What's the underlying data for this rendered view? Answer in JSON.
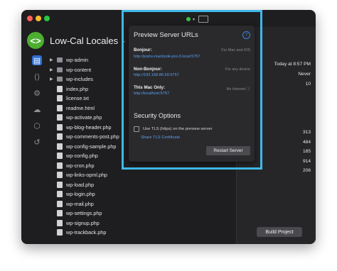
{
  "project": {
    "name": "Low-Cal Locales",
    "logo_glyph": "<>"
  },
  "sidebar_icons": [
    "files-icon",
    "code-icon",
    "settings-icon",
    "cloud-icon",
    "box-icon",
    "history-icon"
  ],
  "files": [
    {
      "name": "wp-admin",
      "type": "folder"
    },
    {
      "name": "wp-content",
      "type": "folder"
    },
    {
      "name": "wp-includes",
      "type": "folder"
    },
    {
      "name": "index.php",
      "type": "file"
    },
    {
      "name": "license.txt",
      "type": "file"
    },
    {
      "name": "readme.html",
      "type": "file"
    },
    {
      "name": "wp-activate.php",
      "type": "file"
    },
    {
      "name": "wp-blog-header.php",
      "type": "file"
    },
    {
      "name": "wp-comments-post.php",
      "type": "file"
    },
    {
      "name": "wp-config-sample.php",
      "type": "file"
    },
    {
      "name": "wp-config.php",
      "type": "file"
    },
    {
      "name": "wp-cron.php",
      "type": "file"
    },
    {
      "name": "wp-links-opml.php",
      "type": "file"
    },
    {
      "name": "wp-load.php",
      "type": "file"
    },
    {
      "name": "wp-login.php",
      "type": "file"
    },
    {
      "name": "wp-mail.php",
      "type": "file"
    },
    {
      "name": "wp-settings.php",
      "type": "file"
    },
    {
      "name": "wp-signup.php",
      "type": "file"
    },
    {
      "name": "wp-trackback.php",
      "type": "file"
    }
  ],
  "right_panel": {
    "values_top": [
      "Today at 8:57 PM",
      "Never",
      "10"
    ],
    "values_bottom": [
      "313",
      "484",
      "185",
      "914",
      "206"
    ],
    "build_button": "Build Project"
  },
  "popover": {
    "title": "Preview Server URLs",
    "help": "?",
    "sections": [
      {
        "label": "Bonjour:",
        "note": "For Mac and iOS",
        "url": "http://joshs-macbook-pro-3.local:5757"
      },
      {
        "label": "Non-Bonjour:",
        "note": "For any device",
        "url": "http://192.168.86.69:5757"
      },
      {
        "label": "This Mac Only:",
        "note": "No Internet ⓘ",
        "url": "http://localhost:5757"
      }
    ],
    "security_title": "Security Options",
    "tls_label": "Use TLS (https) on the preview server",
    "share_link": "Share TLS Certificate",
    "restart_button": "Restart Server"
  }
}
